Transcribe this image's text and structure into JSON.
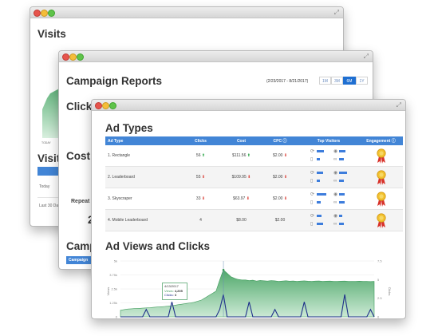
{
  "window_back": {
    "title": "Visits",
    "labels": [
      "Visits",
      "Today",
      "Last 30 Da"
    ],
    "chart_x_label": "TODAY"
  },
  "window_middle": {
    "title": "Campaign Reports",
    "date_range": "(2/23/2017 - 8/21/2017)",
    "range_buttons": [
      "1M",
      "3M",
      "6M",
      "1Y"
    ],
    "active_range": "6M",
    "partial_labels": [
      "Click",
      "Cost",
      "Repeat",
      "2",
      "Camp",
      "Campaign"
    ]
  },
  "window_front": {
    "title": "Ad Types",
    "table": {
      "headers": [
        "Ad Type",
        "Clicks",
        "Cost",
        "CPC",
        "Top Visitors",
        "Engagement"
      ],
      "rows": [
        {
          "ad_type": "1. Rectangle",
          "clicks": "56",
          "clicks_trend": "up",
          "cost": "$111.56",
          "cost_trend": "up",
          "cpc": "$2.00",
          "cpc_trend": "down",
          "visitor_bars": [
            0.45,
            0.4,
            0.2,
            0.3
          ]
        },
        {
          "ad_type": "2. Leaderboard",
          "clicks": "55",
          "clicks_trend": "down",
          "cost": "$109.95",
          "cost_trend": "down",
          "cpc": "$2.00",
          "cpc_trend": "down",
          "visitor_bars": [
            0.4,
            0.5,
            0.2,
            0.3
          ]
        },
        {
          "ad_type": "3. Skyscraper",
          "clicks": "33",
          "clicks_trend": "down",
          "cost": "$63.97",
          "cost_trend": "down",
          "cpc": "$2.00",
          "cpc_trend": "down",
          "visitor_bars": [
            0.6,
            0.35,
            0.25,
            0.35
          ]
        },
        {
          "ad_type": "4. Mobile Leaderboard",
          "clicks": "4",
          "clicks_trend": "",
          "cost": "$8.00",
          "cost_trend": "",
          "cpc": "$2.00",
          "cpc_trend": "",
          "visitor_bars": [
            0.3,
            0.2,
            0.4,
            0.3
          ]
        }
      ]
    },
    "chart_title": "Ad Views and Clicks",
    "tooltip": {
      "date": "4/13/2017",
      "views_label": "Views:",
      "views": "4,205",
      "clicks_label": "Clicks:",
      "clicks": "3"
    }
  },
  "chart_data": {
    "type": "area",
    "title": "Ad Views and Clicks",
    "series": [
      {
        "name": "Views",
        "values": [
          600,
          650,
          700,
          720,
          740,
          760,
          780,
          800,
          820,
          850,
          880,
          900,
          930,
          960,
          1000,
          1050,
          1100,
          1150,
          1200,
          1250,
          1300,
          1400,
          1500,
          1700,
          1900,
          2100,
          2300,
          3300,
          4205,
          3900,
          3600,
          3450,
          3350,
          3300,
          3300,
          3250,
          3280,
          3200,
          3260,
          3230,
          3200,
          3250,
          3220,
          3180,
          3200,
          3230,
          3190,
          3210,
          3180,
          3200,
          3220,
          3190,
          3170,
          3200,
          3210,
          3180,
          3190,
          3200,
          3170,
          3180,
          3190,
          3200,
          3180,
          3170,
          3180,
          3190,
          3170,
          3180,
          3160,
          3170
        ]
      },
      {
        "name": "Clicks",
        "values": [
          0,
          0,
          0,
          0,
          0,
          0,
          0,
          1,
          0,
          0,
          0,
          0,
          0,
          0,
          2,
          0,
          0,
          0,
          0,
          0,
          0,
          0,
          0,
          0,
          0,
          0,
          0,
          1,
          3,
          0,
          0,
          0,
          0,
          0,
          0,
          2,
          0,
          0,
          0,
          0,
          0,
          0,
          1,
          0,
          0,
          0,
          0,
          0,
          0,
          0,
          2,
          0,
          0,
          0,
          0,
          0,
          0,
          0,
          0,
          0,
          0,
          3,
          0,
          0,
          0,
          0,
          0,
          0,
          1,
          0
        ]
      }
    ],
    "ylim": [
      0,
      5000
    ],
    "y2lim": [
      0,
      7.5
    ],
    "ylabel": "Views",
    "y2label": "Clicks"
  },
  "colors": {
    "accent": "#4285d6",
    "active": "#1f6fd1",
    "area": "#5fb37a",
    "click_line": "#1e2f8a"
  },
  "icons": [
    "maximize-icon",
    "refresh-icon",
    "eye-icon",
    "link-icon",
    "phone-icon",
    "medal-icon",
    "info-icon"
  ]
}
